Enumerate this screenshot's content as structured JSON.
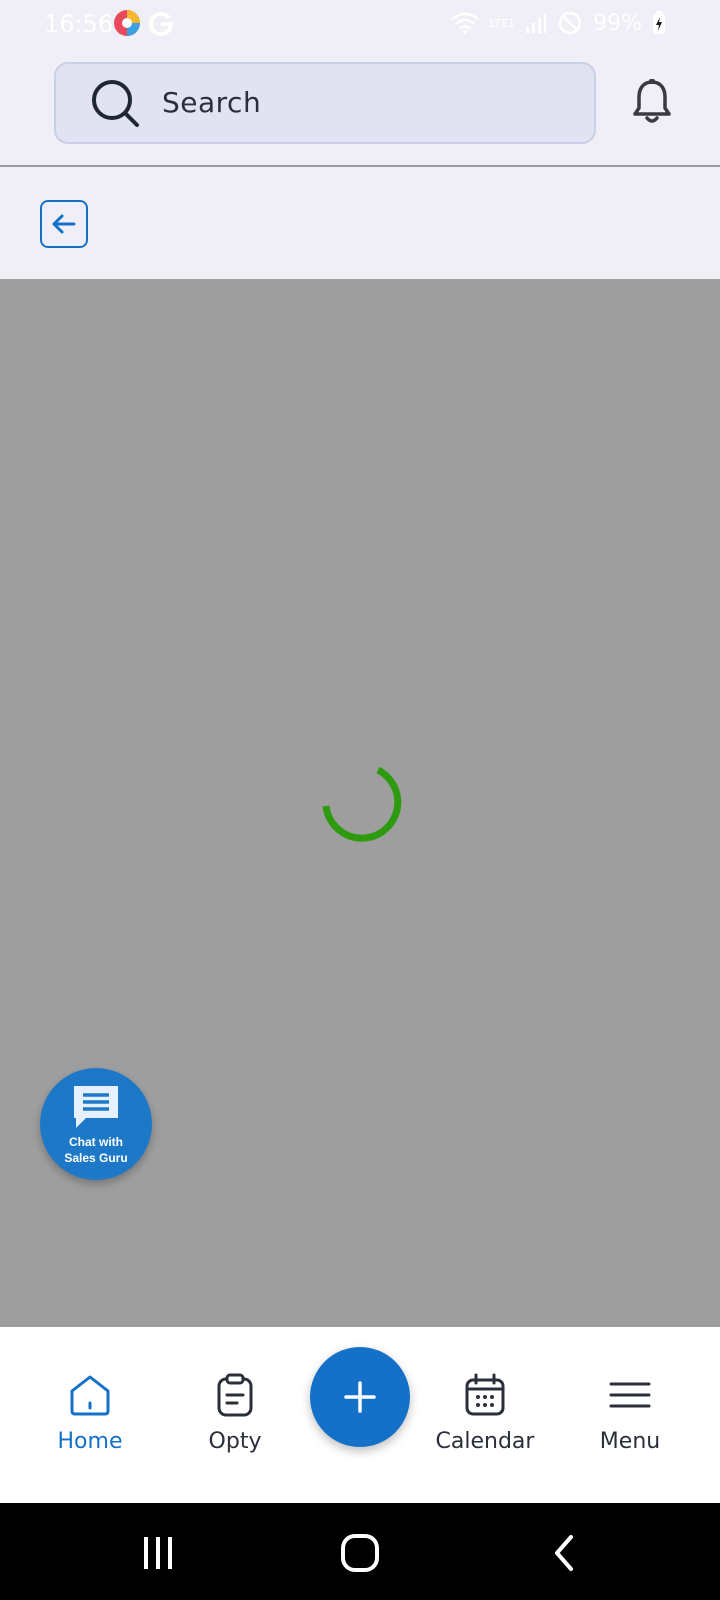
{
  "status_bar": {
    "time": "16:56",
    "battery": "99%",
    "network": "LTE1"
  },
  "header": {
    "search_placeholder": "Search"
  },
  "chat_fab": {
    "line1": "Chat with",
    "line2": "Sales Guru"
  },
  "bottom_nav": {
    "items": [
      {
        "label": "Home",
        "icon": "home-icon",
        "active": true
      },
      {
        "label": "Opty",
        "icon": "clipboard-icon",
        "active": false
      },
      {
        "label": "Calendar",
        "icon": "calendar-icon",
        "active": false
      },
      {
        "label": "Menu",
        "icon": "menu-icon",
        "active": false
      }
    ],
    "add_icon": "plus-icon"
  },
  "colors": {
    "accent": "#1571c8",
    "spinner": "#2e9a10",
    "overlay": "#9e9e9e",
    "chat_fab": "#1d79c8"
  }
}
